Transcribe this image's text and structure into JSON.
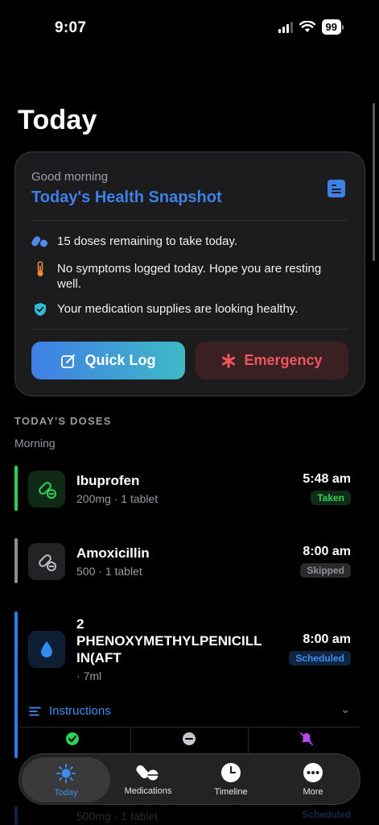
{
  "status_bar": {
    "time": "9:07",
    "battery": "99"
  },
  "page": {
    "title": "Today"
  },
  "snapshot": {
    "greeting": "Good morning",
    "title": "Today's Health Snapshot",
    "items": [
      {
        "icon": "pills-icon",
        "text": "15 doses remaining to take today."
      },
      {
        "icon": "thermometer-icon",
        "text": "No symptoms logged today. Hope you are resting well."
      },
      {
        "icon": "shield-check-icon",
        "text": "Your medication supplies are looking healthy."
      }
    ],
    "quick_log_label": "Quick Log",
    "emergency_label": "Emergency"
  },
  "doses": {
    "section_label": "TODAY'S DOSES",
    "period_label": "Morning",
    "items": [
      {
        "name": "Ibuprofen",
        "dose": "200mg",
        "qty": "1 tablet",
        "time": "5:48 am",
        "status": "Taken",
        "status_color": "#30d158",
        "bar_color": "#30d158"
      },
      {
        "name": "Amoxicillin",
        "dose": "500",
        "qty": "1 tablet",
        "time": "8:00 am",
        "status": "Skipped",
        "status_color": "#8e8e93",
        "bar_color": "#8e8e93"
      },
      {
        "name": "2 PHENOXYMETHYLPENICILLIN(AFT",
        "name_lines": [
          "2",
          "PHENOXYMETHYLPENICILL",
          "IN(AFT"
        ],
        "dose": "",
        "qty": "7ml",
        "time": "8:00 am",
        "status": "Scheduled",
        "status_color": "#3e8ef0",
        "bar_color": "#2f7be8"
      },
      {
        "name": "",
        "dose": "500mg",
        "qty": "1 tablet",
        "time": "",
        "status": "Scheduled",
        "status_color": "#3e8ef0",
        "bar_color": "#2f7be8"
      }
    ],
    "instructions_label": "Instructions"
  },
  "tabbar": {
    "tabs": [
      {
        "label": "Today",
        "icon": "sun-icon",
        "active": true
      },
      {
        "label": "Medications",
        "icon": "pills-icon",
        "active": false
      },
      {
        "label": "Timeline",
        "icon": "clock-icon",
        "active": false
      },
      {
        "label": "More",
        "icon": "more-icon",
        "active": false
      }
    ]
  },
  "colors": {
    "accent": "#3e7fe8",
    "taken": "#30d158",
    "emergency": "#f0565d",
    "background": "#000000",
    "card": "#1c1c1e"
  }
}
